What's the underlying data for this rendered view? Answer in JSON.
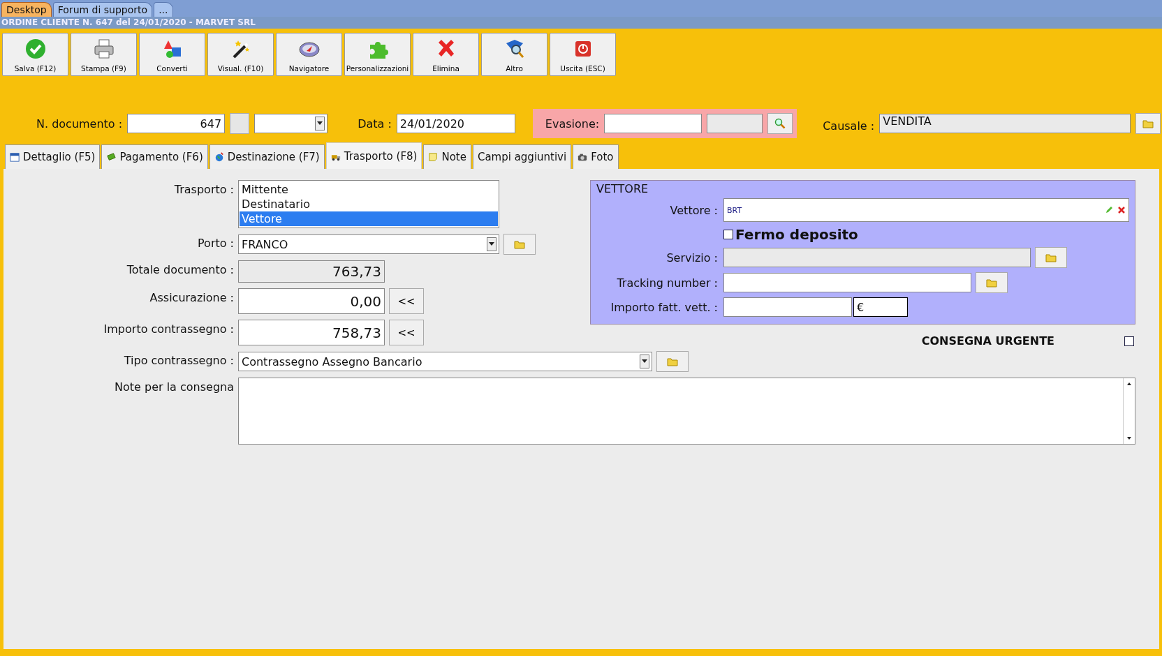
{
  "app_tabs": [
    {
      "label": "Desktop",
      "selected": true
    },
    {
      "label": "Forum di supporto",
      "selected": false
    },
    {
      "label": "...",
      "selected": false
    }
  ],
  "window": {
    "title": "ORDINE CLIENTE N. 647 del 24/01/2020 - MARVET SRL"
  },
  "toolbar": [
    {
      "label": "Salva (F12)",
      "kind": "check"
    },
    {
      "label": "Stampa (F9)",
      "kind": "printer"
    },
    {
      "label": "Converti",
      "kind": "shapes"
    },
    {
      "label": "Visual. (F10)",
      "kind": "wand"
    },
    {
      "label": "Navigatore",
      "kind": "compass"
    },
    {
      "label": "Personalizzazioni",
      "kind": "puzzle"
    },
    {
      "label": "Elimina",
      "kind": "cross"
    },
    {
      "label": "Altro",
      "kind": "book"
    },
    {
      "label": "Uscita (ESC)",
      "kind": "power"
    }
  ],
  "header": {
    "doc_label": "N. documento :",
    "doc_value": "647",
    "data_label": "Data :",
    "data_value": "24/01/2020",
    "evasione_label": "Evasione:",
    "causale_label": "Causale :",
    "causale_value": "VENDITA"
  },
  "tabs": [
    {
      "label": "Dettaglio (F5)",
      "kind": "calendar",
      "selected": false
    },
    {
      "label": "Pagamento (F6)",
      "kind": "money",
      "selected": false
    },
    {
      "label": "Destinazione (F7)",
      "kind": "globe",
      "selected": false
    },
    {
      "label": "Trasporto (F8)",
      "kind": "truck",
      "selected": true
    },
    {
      "label": "Note",
      "kind": "note",
      "selected": false
    },
    {
      "label": "Campi aggiuntivi",
      "kind": "none",
      "selected": false
    },
    {
      "label": "Foto",
      "kind": "camera",
      "selected": false
    }
  ],
  "form": {
    "trasporto_label": "Trasporto :",
    "trasporto_options": [
      {
        "label": "Mittente",
        "selected": false
      },
      {
        "label": "Destinatario",
        "selected": false
      },
      {
        "label": "Vettore",
        "selected": true
      }
    ],
    "porto_label": "Porto :",
    "porto_value": "FRANCO",
    "totale_label": "Totale documento :",
    "totale_value": "763,73",
    "assicurazione_label": "Assicurazione :",
    "assicurazione_value": "0,00",
    "assicurazione_button": "<<",
    "contrassegno_label": "Importo contrassegno :",
    "contrassegno_value": "758,73",
    "contrassegno_button": "<<",
    "tipo_label": "Tipo contrassegno :",
    "tipo_value": "Contrassegno Assegno Bancario",
    "note_label": "Note per la consegna"
  },
  "vettore": {
    "legend": "VETTORE",
    "vettore_label": "Vettore :",
    "vettore_value": "BRT",
    "fermo_label": "Fermo deposito",
    "fermo_checked": false,
    "servizio_label": "Servizio :",
    "tracking_label": "Tracking number :",
    "importo_label": "Importo fatt. vett. :",
    "currency": "€"
  },
  "urgente": {
    "label": "CONSEGNA URGENTE",
    "checked": false
  }
}
